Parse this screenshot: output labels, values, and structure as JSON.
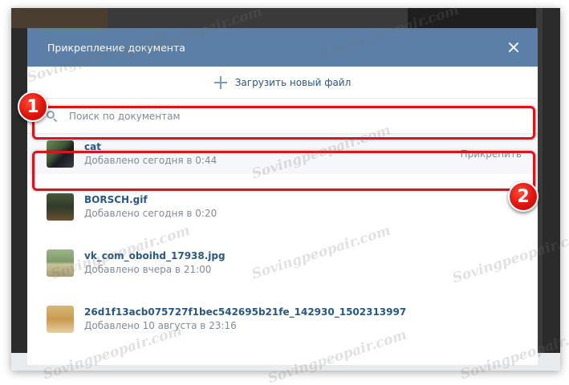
{
  "modal": {
    "title": "Прикрепление документа",
    "upload_label": "Загрузить новый файл",
    "search_placeholder": "Поиск по документам"
  },
  "documents": [
    {
      "name": "cat",
      "date": "Добавлено сегодня в 0:44",
      "action": "Прикрепить"
    },
    {
      "name": "BORSCH.gif",
      "date": "Добавлено сегодня в 0:20"
    },
    {
      "name": "vk_com_oboihd_17938.jpg",
      "date": "Добавлено вчера в 21:00"
    },
    {
      "name": "26d1f13acb075727f1bec542695b21fe_142930_1502313997",
      "date": "Добавлено 10 августа в 23:16"
    }
  ],
  "markers": [
    "1",
    "2"
  ],
  "watermark": "Sovingpeopair.com",
  "colors": {
    "header": "#5b7fa6",
    "link": "#2a5885",
    "muted": "#818c99",
    "highlight": "#d9141c"
  }
}
